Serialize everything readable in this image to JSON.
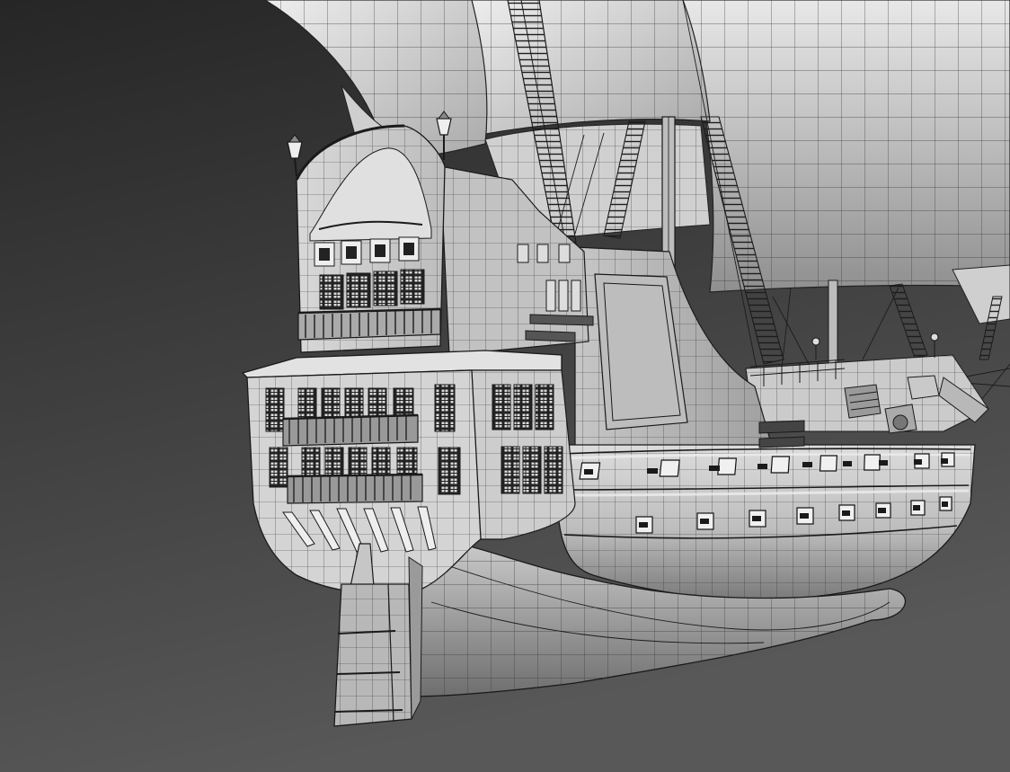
{
  "viewport": {
    "background_top": "#2c2c2c",
    "background_bottom": "#555555",
    "wire_color": "#1a1a1a"
  },
  "model": {
    "subject": "sailing-ship",
    "render_mode": "shaded-wireframe",
    "parts": [
      "sails",
      "rigging",
      "stern-castle",
      "hull",
      "rudder",
      "gun-ports",
      "lanterns"
    ]
  }
}
